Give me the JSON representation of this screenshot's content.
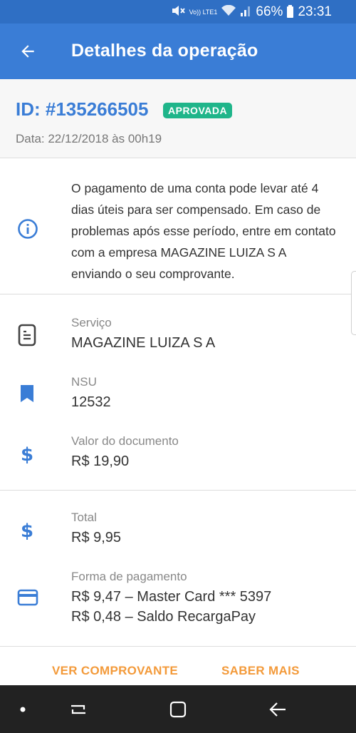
{
  "status_bar": {
    "volte": "Vo)) LTE1",
    "battery_percent": "66%",
    "time": "23:31"
  },
  "app_bar": {
    "title": "Detalhes da operação",
    "back_icon": "arrow-left-icon"
  },
  "operation": {
    "id": "ID: #135266505",
    "status_badge": "APROVADA",
    "date": "Data: 22/12/2018 às 00h19"
  },
  "info": {
    "icon": "info-icon",
    "message": "O pagamento de uma conta pode levar até 4 dias úteis para ser compensado. Em caso de problemas após esse período, entre em contato com a empresa MAGAZINE LUIZA S A enviando o seu comprovante."
  },
  "details": {
    "service": {
      "icon": "receipt-icon",
      "label": "Serviço",
      "value": "MAGAZINE LUIZA S A"
    },
    "nsu": {
      "icon": "bookmark-icon",
      "label": "NSU",
      "value": "12532"
    },
    "document_value": {
      "icon": "dollar-icon",
      "label": "Valor do documento",
      "value": "R$ 19,90"
    }
  },
  "payment": {
    "total": {
      "icon": "dollar-icon",
      "label": "Total",
      "value": "R$ 9,95"
    },
    "method": {
      "icon": "credit-card-icon",
      "label": "Forma de pagamento",
      "lines": [
        "R$ 9,47 – Master Card *** 5397",
        "R$ 0,48 – Saldo RecargaPay"
      ]
    }
  },
  "actions": {
    "view_receipt": "VER COMPROVANTE",
    "learn_more": "SABER MAIS"
  },
  "colors": {
    "primary": "#3a7dd6",
    "status_bar": "#2f6fc4",
    "approved": "#1fb58a",
    "accent": "#f39a3a"
  }
}
